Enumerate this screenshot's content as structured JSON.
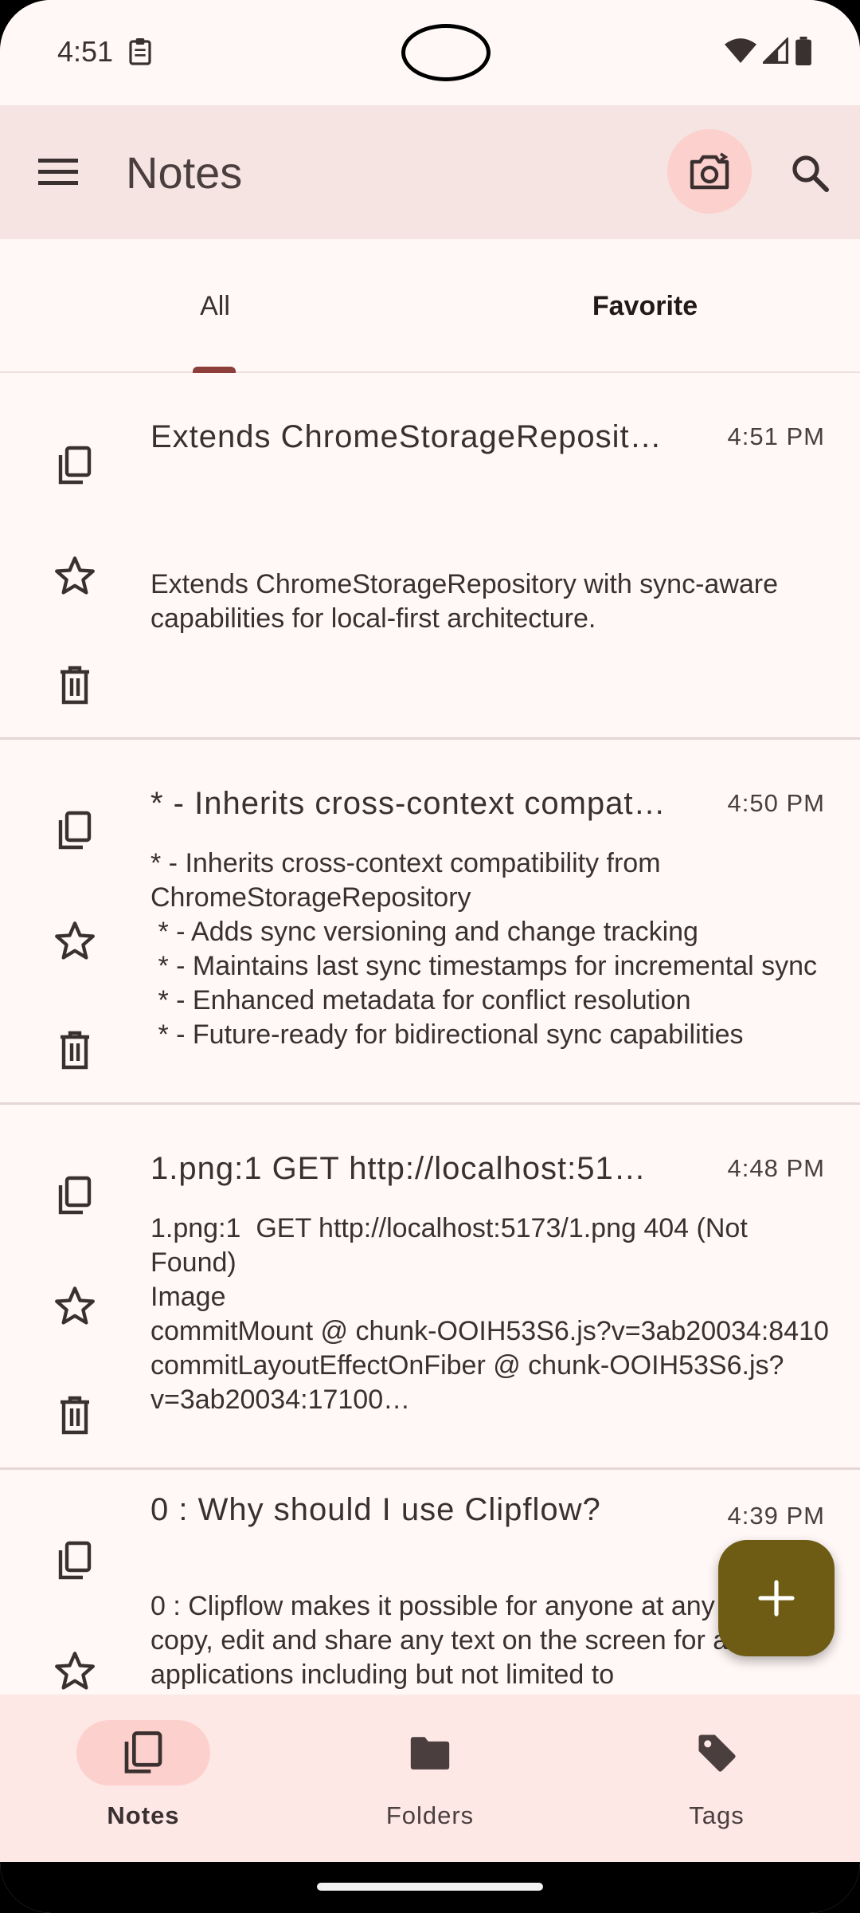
{
  "status_bar": {
    "time": "4:51"
  },
  "app_bar": {
    "title": "Notes"
  },
  "tabs": [
    {
      "label": "All",
      "selected": true
    },
    {
      "label": "Favorite",
      "selected": false
    }
  ],
  "notes": [
    {
      "title": "Extends ChromeStorageReposit…",
      "time": "4:51 PM",
      "body": "Extends ChromeStorageRepository with sync-aware capabilities for local-first architecture."
    },
    {
      "title": "* - Inherits cross-context compat…",
      "time": "4:50 PM",
      "body": "* - Inherits cross-context compatibility from ChromeStorageRepository\n * - Adds sync versioning and change tracking\n * - Maintains last sync timestamps for incremental sync\n * - Enhanced metadata for conflict resolution\n * - Future-ready for bidirectional sync capabilities"
    },
    {
      "title": "1.png:1  GET http://localhost:51…",
      "time": "4:48 PM",
      "body": "1.png:1  GET http://localhost:5173/1.png 404 (Not Found)\nImage\ncommitMount @ chunk-OOIH53S6.js?v=3ab20034:8410\ncommitLayoutEffectOnFiber @ chunk-OOIH53S6.js?v=3ab20034:17100…"
    },
    {
      "title": "0 : Why should I use Clipflow?",
      "time": "4:39 PM",
      "body": "0 : Clipflow makes it possible for anyone at any time to copy, edit and share any text on the screen for any applications including but not limited to"
    }
  ],
  "fab": {
    "icon": "plus-icon",
    "color": "#6e5c14"
  },
  "bottom_nav": [
    {
      "label": "Notes",
      "icon": "notes-icon",
      "active": true
    },
    {
      "label": "Folders",
      "icon": "folder-icon",
      "active": false
    },
    {
      "label": "Tags",
      "icon": "tag-icon",
      "active": false
    }
  ],
  "colors": {
    "background": "#fff8f7",
    "app_bar": "#f5e4e2",
    "accent": "#8b3e3a",
    "bottom_nav": "#fde8e6",
    "pill": "#fcd0cd"
  }
}
